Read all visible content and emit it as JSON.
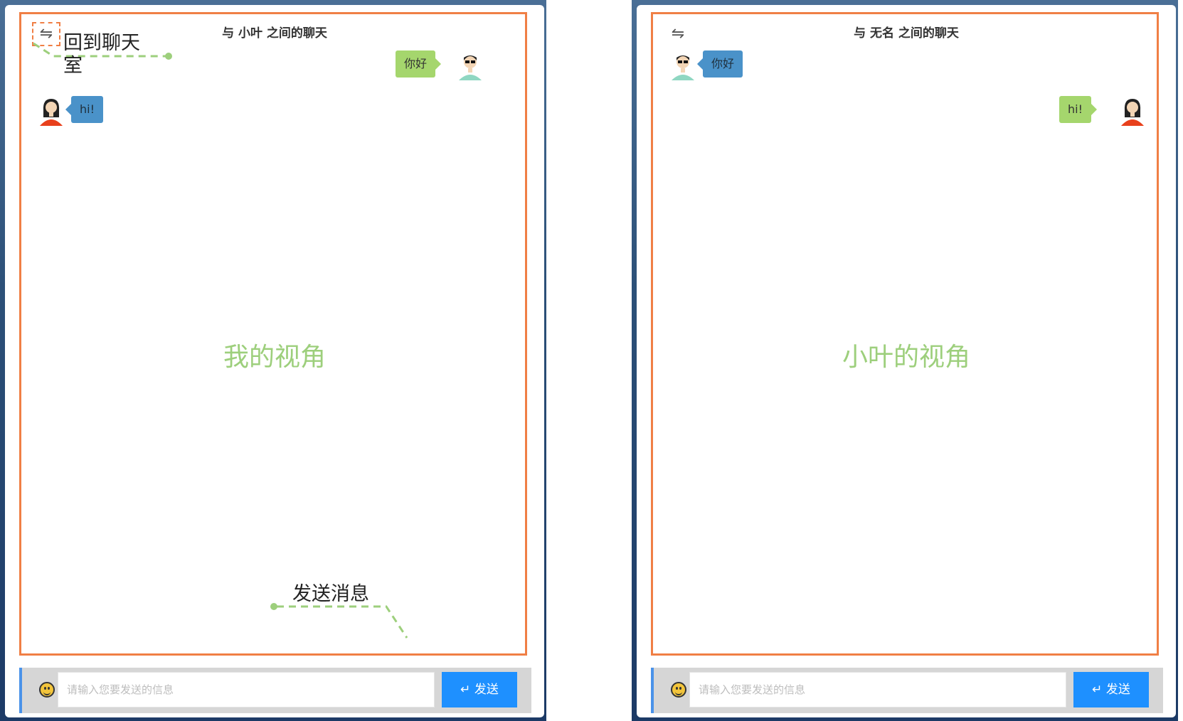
{
  "left": {
    "title": "与 小叶 之间的聊天",
    "back_icon": "⇋",
    "caption": "我的视角",
    "messages": [
      {
        "side": "right",
        "text": "你好",
        "avatar": "male-avatar",
        "color": "green"
      },
      {
        "side": "left",
        "text": "hi!",
        "avatar": "female-avatar",
        "color": "blue"
      }
    ],
    "input_placeholder": "请输入您要发送的信息",
    "send_label": "↵ 发送",
    "annotations": {
      "back": "回到聊天室",
      "send": "发送消息"
    }
  },
  "right": {
    "title": "与 无名 之间的聊天",
    "back_icon": "⇋",
    "caption": "小叶的视角",
    "messages": [
      {
        "side": "left",
        "text": "你好",
        "avatar": "male-avatar",
        "color": "blue"
      },
      {
        "side": "right",
        "text": "hi!",
        "avatar": "female-avatar",
        "color": "green"
      }
    ],
    "input_placeholder": "请输入您要发送的信息",
    "send_label": "↵ 发送"
  },
  "colors": {
    "frame": "#f07f45",
    "green_bubble": "#a5d66d",
    "blue_bubble": "#4a92c9",
    "send_button": "#1e90ff",
    "caption": "#9dcf7c"
  }
}
